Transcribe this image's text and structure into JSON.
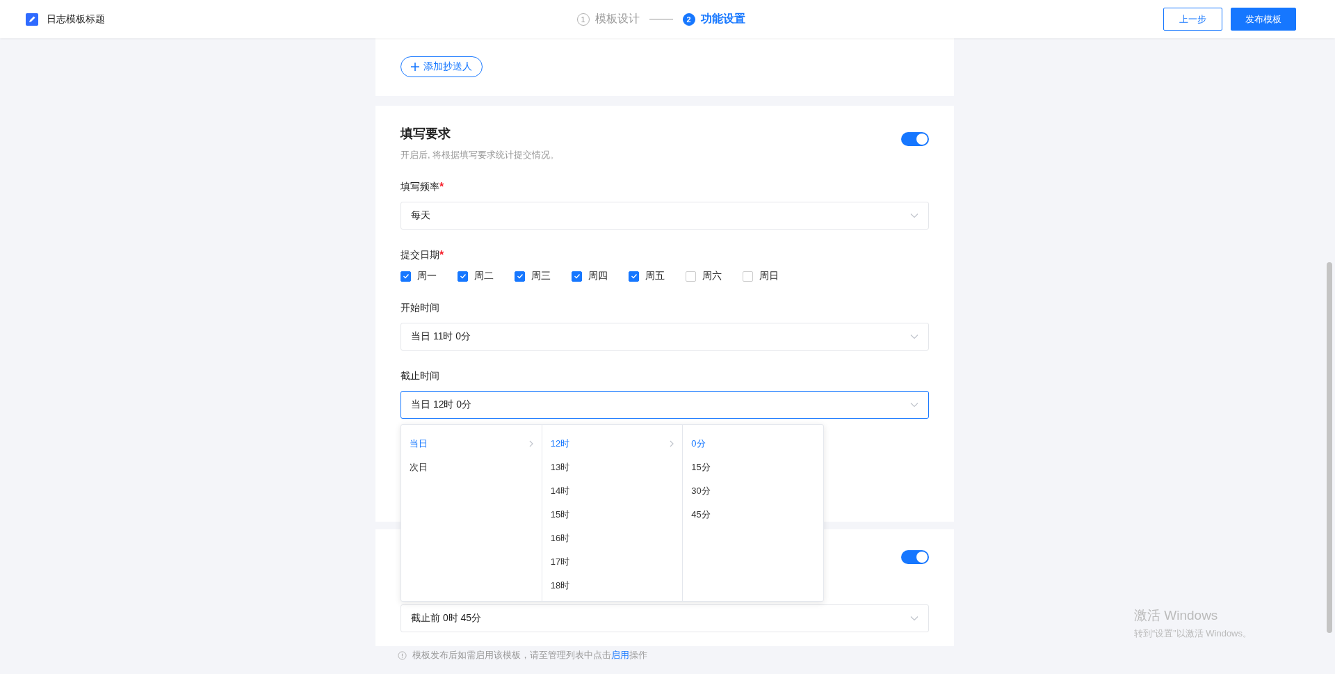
{
  "header": {
    "title": "日志模板标题",
    "steps": [
      {
        "number": "1",
        "label": "模板设计",
        "selected": false
      },
      {
        "number": "2",
        "label": "功能设置",
        "selected": true
      }
    ],
    "buttons": [
      {
        "label": "上一步",
        "kind": "outline"
      },
      {
        "label": "发布模板",
        "kind": "primary"
      }
    ]
  },
  "cc_card": {
    "add_button": "添加抄送人"
  },
  "requirement_card": {
    "title": "填写要求",
    "description": "开启后, 将根据填写要求统计提交情况。",
    "on": true,
    "fields": [
      {
        "kind": "select",
        "label": "填写频率",
        "required_mark": "*",
        "value": "每天",
        "focused": false
      },
      {
        "kind": "checkboxes",
        "label": "提交日期",
        "required_mark": "*",
        "options": [
          {
            "label": "周一",
            "checked": true
          },
          {
            "label": "周二",
            "checked": true
          },
          {
            "label": "周三",
            "checked": true
          },
          {
            "label": "周四",
            "checked": true
          },
          {
            "label": "周五",
            "checked": true
          },
          {
            "label": "周六",
            "checked": false
          },
          {
            "label": "周日",
            "checked": false
          }
        ]
      },
      {
        "kind": "select",
        "label": "开始时间",
        "value": "当日 11时 0分",
        "focused": false
      },
      {
        "kind": "select",
        "label": "截止时间",
        "value": "当日 12时 0分",
        "focused": true
      }
    ]
  },
  "cascader": {
    "columns": [
      [
        {
          "label": "当日",
          "selected": true,
          "has_children": true
        },
        {
          "label": "次日",
          "selected": false,
          "has_children": false
        }
      ],
      [
        {
          "label": "12时",
          "selected": true,
          "has_children": true
        },
        {
          "label": "13时",
          "selected": false,
          "has_children": false
        },
        {
          "label": "14时",
          "selected": false,
          "has_children": false
        },
        {
          "label": "15时",
          "selected": false,
          "has_children": false
        },
        {
          "label": "16时",
          "selected": false,
          "has_children": false
        },
        {
          "label": "17时",
          "selected": false,
          "has_children": false
        },
        {
          "label": "18时",
          "selected": false,
          "has_children": false
        }
      ],
      [
        {
          "label": "0分",
          "selected": true,
          "has_children": false
        },
        {
          "label": "15分",
          "selected": false,
          "has_children": false
        },
        {
          "label": "30分",
          "selected": false,
          "has_children": false
        },
        {
          "label": "45分",
          "selected": false,
          "has_children": false
        }
      ]
    ]
  },
  "reminder_card": {
    "on": true,
    "value": "截止前 0时 45分"
  },
  "hint": {
    "before": "模板发布后如需启用该模板，请至管理列表中点击",
    "link": "启用",
    "after": "操作"
  },
  "os_notice": {
    "title": "激活 Windows",
    "text": "转到“设置”以激活 Windows。"
  }
}
